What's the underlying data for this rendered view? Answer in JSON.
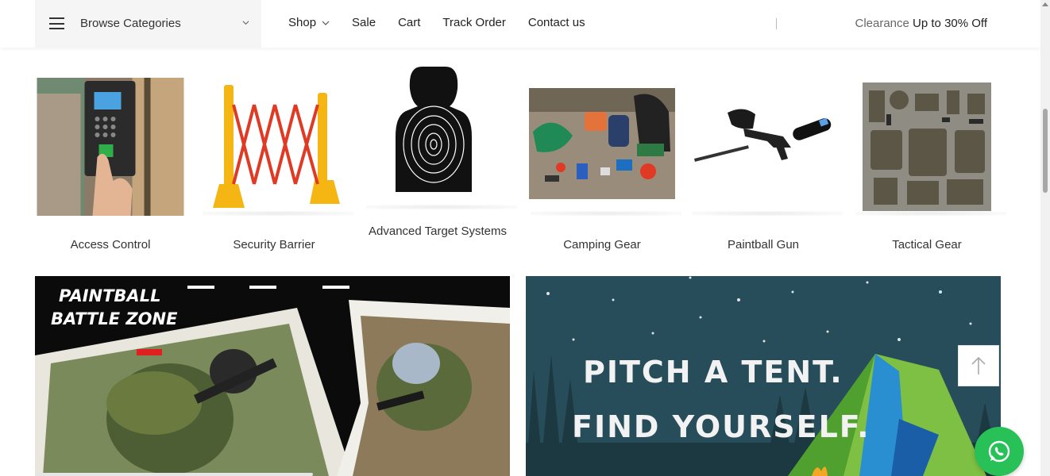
{
  "nav": {
    "browse_label": "Browse Categories",
    "links": [
      {
        "label": "Shop",
        "has_dropdown": true
      },
      {
        "label": "Sale",
        "has_dropdown": false
      },
      {
        "label": "Cart",
        "has_dropdown": false
      },
      {
        "label": "Track Order",
        "has_dropdown": false
      },
      {
        "label": "Contact us",
        "has_dropdown": false
      }
    ],
    "clearance_prefix": "Clearance",
    "clearance_offer": "Up to 30% Off"
  },
  "categories": [
    {
      "label": "Access Control"
    },
    {
      "label": "Security Barrier"
    },
    {
      "label": "Advanced Target Systems"
    },
    {
      "label": "Camping Gear"
    },
    {
      "label": "Paintball Gun"
    },
    {
      "label": "Tactical Gear"
    }
  ],
  "banners": {
    "left": {
      "line1": "PAINTBALL",
      "line2": "BATTLE ZONE"
    },
    "right": {
      "line1": "PITCH A TENT.",
      "line2": "FIND YOURSELF."
    }
  },
  "colors": {
    "whatsapp": "#27c158",
    "nav_bg": "#f5f5f5",
    "tent_sky": "#274c5a"
  }
}
